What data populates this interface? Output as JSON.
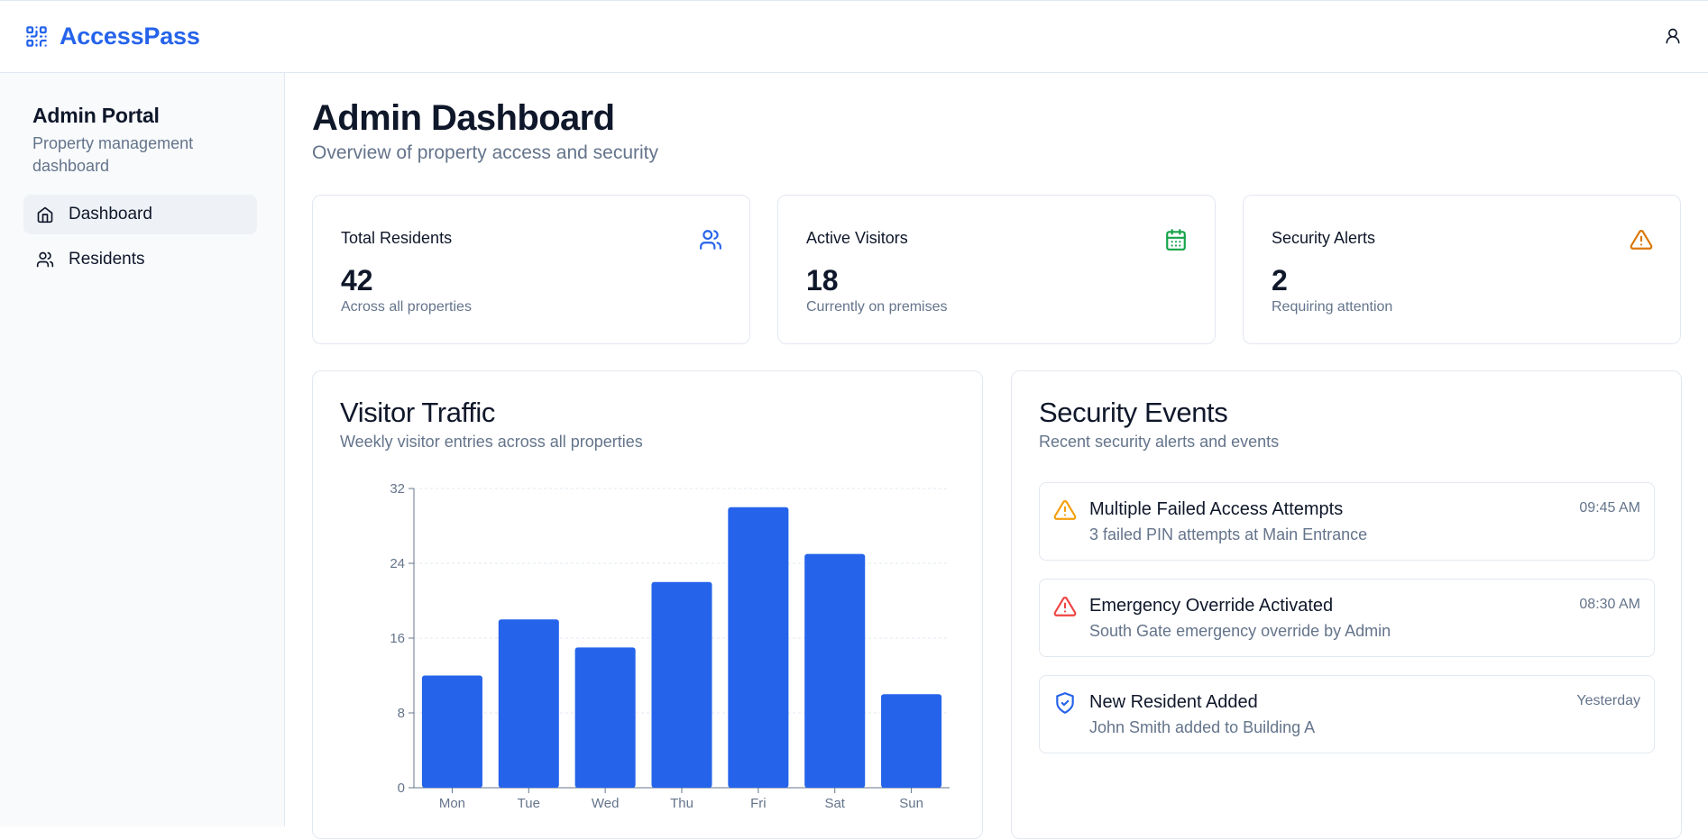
{
  "app": {
    "name": "AccessPass",
    "brand_color": "#2563eb"
  },
  "sidebar": {
    "title": "Admin Portal",
    "subtitle": "Property management dashboard",
    "items": [
      {
        "label": "Dashboard",
        "icon": "home-icon",
        "active": true
      },
      {
        "label": "Residents",
        "icon": "users-icon",
        "active": false
      }
    ]
  },
  "header": {
    "title": "Admin Dashboard",
    "subtitle": "Overview of property access and security"
  },
  "stats": [
    {
      "label": "Total Residents",
      "value": "42",
      "desc": "Across all properties",
      "icon": "users-icon",
      "color": "#2563eb"
    },
    {
      "label": "Active Visitors",
      "value": "18",
      "desc": "Currently on premises",
      "icon": "calendar-icon",
      "color": "#16a34a"
    },
    {
      "label": "Security Alerts",
      "value": "2",
      "desc": "Requiring attention",
      "icon": "alert-triangle-icon",
      "color": "#d97706"
    }
  ],
  "traffic": {
    "title": "Visitor Traffic",
    "subtitle": "Weekly visitor entries across all properties"
  },
  "chart_data": {
    "type": "bar",
    "categories": [
      "Mon",
      "Tue",
      "Wed",
      "Thu",
      "Fri",
      "Sat",
      "Sun"
    ],
    "values": [
      12,
      18,
      15,
      22,
      30,
      25,
      10
    ],
    "title": "",
    "xlabel": "",
    "ylabel": "",
    "ylim": [
      0,
      32
    ],
    "yticks": [
      0,
      8,
      16,
      24,
      32
    ],
    "grid": true,
    "bar_color": "#2563eb"
  },
  "security": {
    "title": "Security Events",
    "subtitle": "Recent security alerts and events",
    "events": [
      {
        "title": "Multiple Failed Access Attempts",
        "desc": "3 failed PIN attempts at Main Entrance",
        "time": "09:45 AM",
        "icon": "alert-triangle-icon",
        "color": "#f59e0b"
      },
      {
        "title": "Emergency Override Activated",
        "desc": "South Gate emergency override by Admin",
        "time": "08:30 AM",
        "icon": "alert-triangle-icon",
        "color": "#ef4444"
      },
      {
        "title": "New Resident Added",
        "desc": "John Smith added to Building A",
        "time": "Yesterday",
        "icon": "shield-check-icon",
        "color": "#2563eb"
      }
    ]
  }
}
